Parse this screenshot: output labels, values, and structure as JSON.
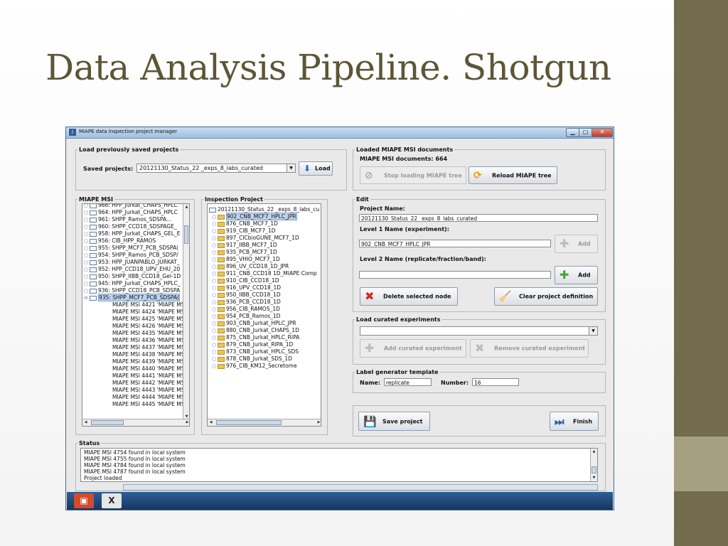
{
  "slide": {
    "title": "Data Analysis Pipeline. Shotgun",
    "accent_dark": "#726b4e",
    "accent_light": "#a5a080"
  },
  "window": {
    "title": "MIAPE data inspection project manager",
    "app_icon": "java-app-icon",
    "controls": {
      "minimize": "▁",
      "maximize": "□",
      "close": "✕"
    }
  },
  "load_projects": {
    "legend": "Load previously saved projects",
    "label": "Saved projects:",
    "selected": "20121130_Status_22 _exps_8_labs_curated",
    "load_button": "Load",
    "load_icon": "download-arrow-icon"
  },
  "loaded_docs": {
    "legend": "Loaded MIAPE MSI documents",
    "count_label": "MIAPE MSI documents:",
    "count": "664",
    "stop_button": "Stop loading MIAPE tree",
    "reload_button": "Reload MIAPE tree"
  },
  "miape_tree": {
    "legend": "MIAPE MSI",
    "items": [
      "966: HPP_Jurkat_CHAPS_HPLC",
      "964: HPP_Jurkat_CHAPS_HPLC",
      "961: SHPP_Ramos_SDSPA...",
      "960: SHPP_CCD18_SDSPAGE_",
      "958: HPP_Jurkat_CHAPS_GEL_E",
      "956: CIB_HPP_RAMOS",
      "955: SHPP_MCF7_PCB_SDSPA(",
      "954: SHPP_Ramos_PCB_SDSP/",
      "953: HPP_JUANPABLO_JURKAT_",
      "952: HPP_CCD18_UPV_EHU_20",
      "950: SHPP_IIBB_CCD18_Gel-1D",
      "945: HPP_Jurkat_CHAPS_HPLC_",
      "936: SHPP_CCD18_PCB_SDSPA",
      "935: SHPP_MCF7_PCB_SDSPA("
    ],
    "children": [
      "MIAPE MSI 4421 'MIAPE MSI",
      "MIAPE MSI 4424 'MIAPE MSI",
      "MIAPE MSI 4425 'MIAPE MSI",
      "MIAPE MSI 4426 'MIAPE MSI",
      "MIAPE MSI 4435 'MIAPE MSI",
      "MIAPE MSI 4436 'MIAPE MS",
      "MIAPE MSI 4437 'MIAPE MS",
      "MIAPE MSI 4438 'MIAPE MS",
      "MIAPE MSI 4439 'MIAPE MS",
      "MIAPE MSI 4440 'MIAPE MS",
      "MIAPE MSI 4441 'MIAPE MS",
      "MIAPE MSI 4442 'MIAPE MS",
      "MIAPE MSI 4443 'MIAPE MS",
      "MIAPE MSI 4444 'MIAPE MS",
      "MIAPE MSI 4445 'MIAPE MS"
    ]
  },
  "inspection": {
    "legend": "Inspection Project",
    "root": "20121130_Status_22 _exps_8_labs_cu",
    "items": [
      "902_CNB_MCF7_HPLC_JPR",
      "876_CNB_MCF7_1D",
      "919_CIB_MCF7_1D",
      "897_CICbioGUNE_MCF7_1D",
      "917_IIBB_MCF7_1D",
      "935_PCB_MCF7_1D",
      "895_VHIO_MCF7_1D",
      "896_UV_CCD18_1D_JPR",
      "911_CNB_CCD18 1D_MIAPE Comp",
      "910_CIB_CCD18_1D",
      "916_UPV_CCD18_1D",
      "950_IIBB_CCD18_1D",
      "936_PCB_CCD18_1D",
      "956_CIB_RAMOS_1D",
      "954_PCB_Ramos_1D",
      "903_CNB_Jurkat_HPLC_JPR",
      "880_CNB_Jurkat_CHAPS_1D",
      "875_CNB_Jurkat_HPLC_RIPA",
      "879_CNB_Jurkat_RIPA_1D",
      "873_CNB_Jurkat_HPLC_SDS",
      "878_CNB_Jurkat_SDS_1D",
      "976_CIB_KM12_Secretome"
    ]
  },
  "edit": {
    "legend": "Edit",
    "project_name_label": "Project Name:",
    "project_name": "20121130_Status_22 _exps_8_labs_curated",
    "level1_label": "Level 1 Name (experiment):",
    "level1_value": "902_CNB_MCF7_HPLC_JPR",
    "add_label": "Add",
    "level2_label": "Level 2 Name (replicate/fraction/band):",
    "level2_value": "",
    "add2_label": "Add",
    "delete_button": "Delete selected node",
    "clear_button": "Clear project definition"
  },
  "curated": {
    "legend": "Load curated experiments",
    "selected": "",
    "add_button": "Add curated experiment",
    "remove_button": "Remove curated experiment"
  },
  "label_gen": {
    "legend": "Label generator template",
    "name_label": "Name:",
    "name_value": "replicate",
    "number_label": "Number:",
    "number_value": "16"
  },
  "actions": {
    "save_button": "Save project",
    "finish_button": "Finish"
  },
  "status": {
    "legend": "Status",
    "lines": [
      "MIAPE MSI 4754 found in local system",
      "MIAPE MSI 4755 found in local system",
      "MIAPE MSI 4784 found in local system",
      "MIAPE MSI 4787 found in local system",
      "Project loaded"
    ]
  },
  "taskbar": {
    "items": [
      "presentation-app-icon",
      "x11-app-icon"
    ]
  }
}
